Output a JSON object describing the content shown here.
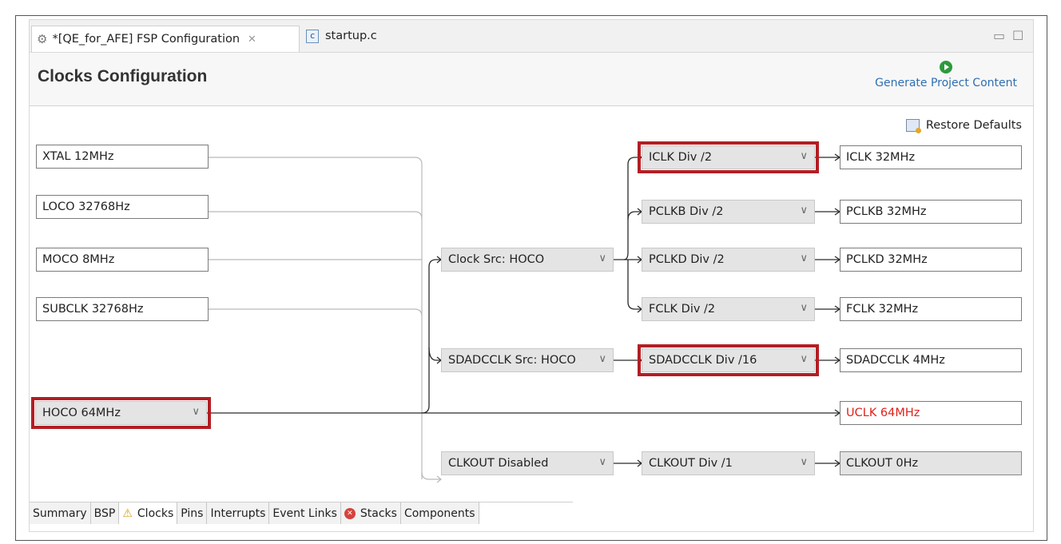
{
  "tabs": [
    {
      "label": "*[QE_for_AFE] FSP Configuration",
      "icon": "gear-icon",
      "active": true
    },
    {
      "label": "startup.c",
      "icon": "c-file-icon",
      "active": false
    }
  ],
  "header": {
    "title": "Clocks Configuration",
    "generate_label": "Generate Project Content"
  },
  "restore_label": "Restore Defaults",
  "sources": {
    "xtal": "XTAL 12MHz",
    "loco": "LOCO 32768Hz",
    "moco": "MOCO 8MHz",
    "subclk": "SUBCLK 32768Hz",
    "hoco": "HOCO 64MHz"
  },
  "selectors": {
    "clock_src": "Clock Src: HOCO",
    "sdadcclk_src": "SDADCCLK Src: HOCO",
    "clkout_src": "CLKOUT Disabled"
  },
  "dividers": {
    "iclk": "ICLK Div /2",
    "pclkb": "PCLKB Div /2",
    "pclkd": "PCLKD Div /2",
    "fclk": "FCLK Div /2",
    "sdadcclk": "SDADCCLK Div /16",
    "clkout": "CLKOUT Div /1"
  },
  "outputs": {
    "iclk": "ICLK 32MHz",
    "pclkb": "PCLKB 32MHz",
    "pclkd": "PCLKD 32MHz",
    "fclk": "FCLK 32MHz",
    "sdadcclk": "SDADCCLK 4MHz",
    "uclk": "UCLK 64MHz",
    "clkout": "CLKOUT 0Hz"
  },
  "colors": {
    "highlight": "#b21e24",
    "uclk_text": "#e0201a",
    "generate_link": "#2f6fb0"
  },
  "bottom_tabs": [
    "Summary",
    "BSP",
    "Clocks",
    "Pins",
    "Interrupts",
    "Event Links",
    "Stacks",
    "Components"
  ]
}
